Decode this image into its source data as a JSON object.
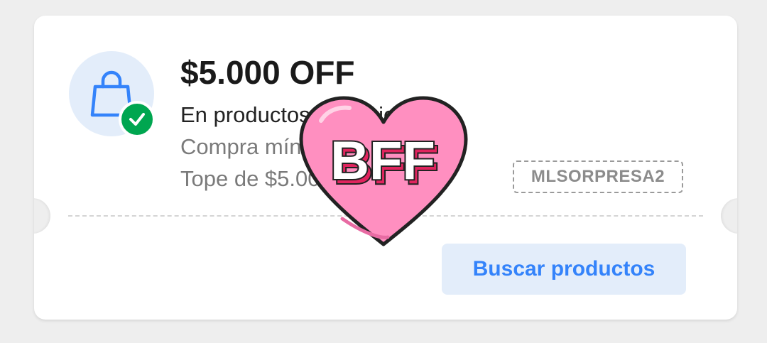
{
  "coupon": {
    "amount": "$5.000 OFF",
    "subtitle": "En productos seleccionados",
    "min_purchase": "Compra mínima de $25.000",
    "cap": "Tope de $5.000",
    "code": "MLSORPRESA2",
    "action_label": "Buscar productos",
    "icon": "shopping-bag-icon",
    "badge_icon": "check-icon"
  },
  "sticker": {
    "text": "BFF",
    "icon": "heart-icon"
  },
  "colors": {
    "page_bg": "#eeeeee",
    "card_bg": "#ffffff",
    "accent_blue": "#3483fa",
    "icon_bg": "#e3edfa",
    "check_green": "#00a650",
    "heart_pink": "#ff8fc0",
    "heart_outline": "#222222",
    "bff_shadow": "#e0245e"
  }
}
